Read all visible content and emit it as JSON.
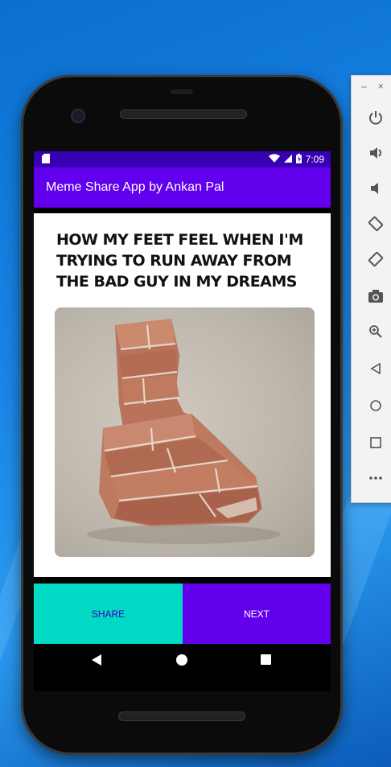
{
  "app": {
    "title": "Meme Share App by Ankan Pal"
  },
  "statusbar": {
    "time": "7:09",
    "icons": [
      "sd-card-icon",
      "wifi-icon",
      "signal-icon",
      "battery-icon"
    ]
  },
  "meme": {
    "caption": "HOW MY FEET FEEL WHEN I'M TRYING TO RUN AWAY FROM THE BAD GUY IN MY DREAMS",
    "image": "brick-shoe-photo"
  },
  "buttons": {
    "share_label": "SHARE",
    "next_label": "NEXT"
  },
  "navbar": {
    "icons": [
      "back-icon",
      "home-icon",
      "recents-icon"
    ]
  },
  "emulator_panel": {
    "window_controls": [
      "–",
      "×"
    ],
    "icons": [
      "power-icon",
      "volume-up-icon",
      "volume-down-icon",
      "rotate-left-icon",
      "rotate-right-icon",
      "camera-icon",
      "zoom-icon",
      "back-icon",
      "home-icon",
      "overview-icon",
      "more-icon"
    ]
  },
  "colors": {
    "primary": "#6200ee",
    "primary_dark": "#3700b3",
    "accent": "#03dac5"
  }
}
